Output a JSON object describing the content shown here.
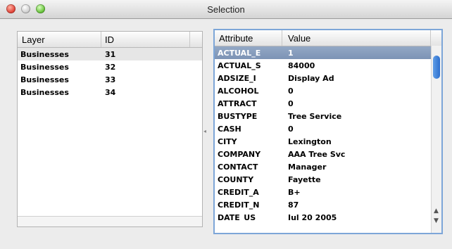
{
  "window": {
    "title": "Selection"
  },
  "left_table": {
    "columns": [
      "Layer",
      "ID"
    ],
    "rows": [
      {
        "layer": "Businesses",
        "id": "31"
      },
      {
        "layer": "Businesses",
        "id": "32"
      },
      {
        "layer": "Businesses",
        "id": "33"
      },
      {
        "layer": "Businesses",
        "id": "34"
      }
    ]
  },
  "right_table": {
    "columns": [
      "Attribute",
      "Value"
    ],
    "rows": [
      {
        "attribute": "ACTUAL_E",
        "value": "1"
      },
      {
        "attribute": "ACTUAL_S",
        "value": "84000"
      },
      {
        "attribute": "ADSIZE_I",
        "value": "Display Ad"
      },
      {
        "attribute": "ALCOHOL",
        "value": "0"
      },
      {
        "attribute": "ATTRACT",
        "value": "0"
      },
      {
        "attribute": "BUSTYPE",
        "value": "Tree Service"
      },
      {
        "attribute": "CASH",
        "value": "0"
      },
      {
        "attribute": "CITY",
        "value": "Lexington"
      },
      {
        "attribute": "COMPANY",
        "value": "AAA Tree Svc"
      },
      {
        "attribute": "CONTACT",
        "value": "Manager"
      },
      {
        "attribute": "COUNTY",
        "value": "Fayette"
      },
      {
        "attribute": "CREDIT_A",
        "value": "B+"
      },
      {
        "attribute": "CREDIT_N",
        "value": "87"
      },
      {
        "attribute": "DATE_US",
        "value": "Jul 20 2005"
      }
    ]
  },
  "icons": {
    "up_arrow": "▲",
    "down_arrow": "▼",
    "resize_handle": "◂"
  }
}
